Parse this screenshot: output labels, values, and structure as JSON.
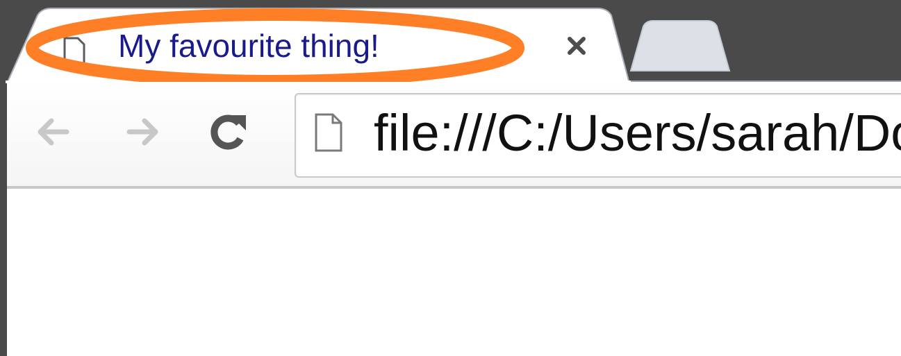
{
  "browser": {
    "tabs": [
      {
        "title": "My favourite thing!",
        "active": true,
        "favicon": "blank-page-icon",
        "close_icon": "close-icon"
      },
      {
        "title": "",
        "active": false
      }
    ],
    "toolbar": {
      "back_icon": "arrow-left-icon",
      "forward_icon": "arrow-right-icon",
      "reload_icon": "reload-icon",
      "back_enabled": false,
      "forward_enabled": false
    },
    "address_bar": {
      "icon": "page-icon",
      "url": "file:///C:/Users/sarah/Do"
    },
    "annotation": {
      "shape": "ellipse",
      "color": "#ff7f27",
      "target": "active tab title"
    }
  }
}
